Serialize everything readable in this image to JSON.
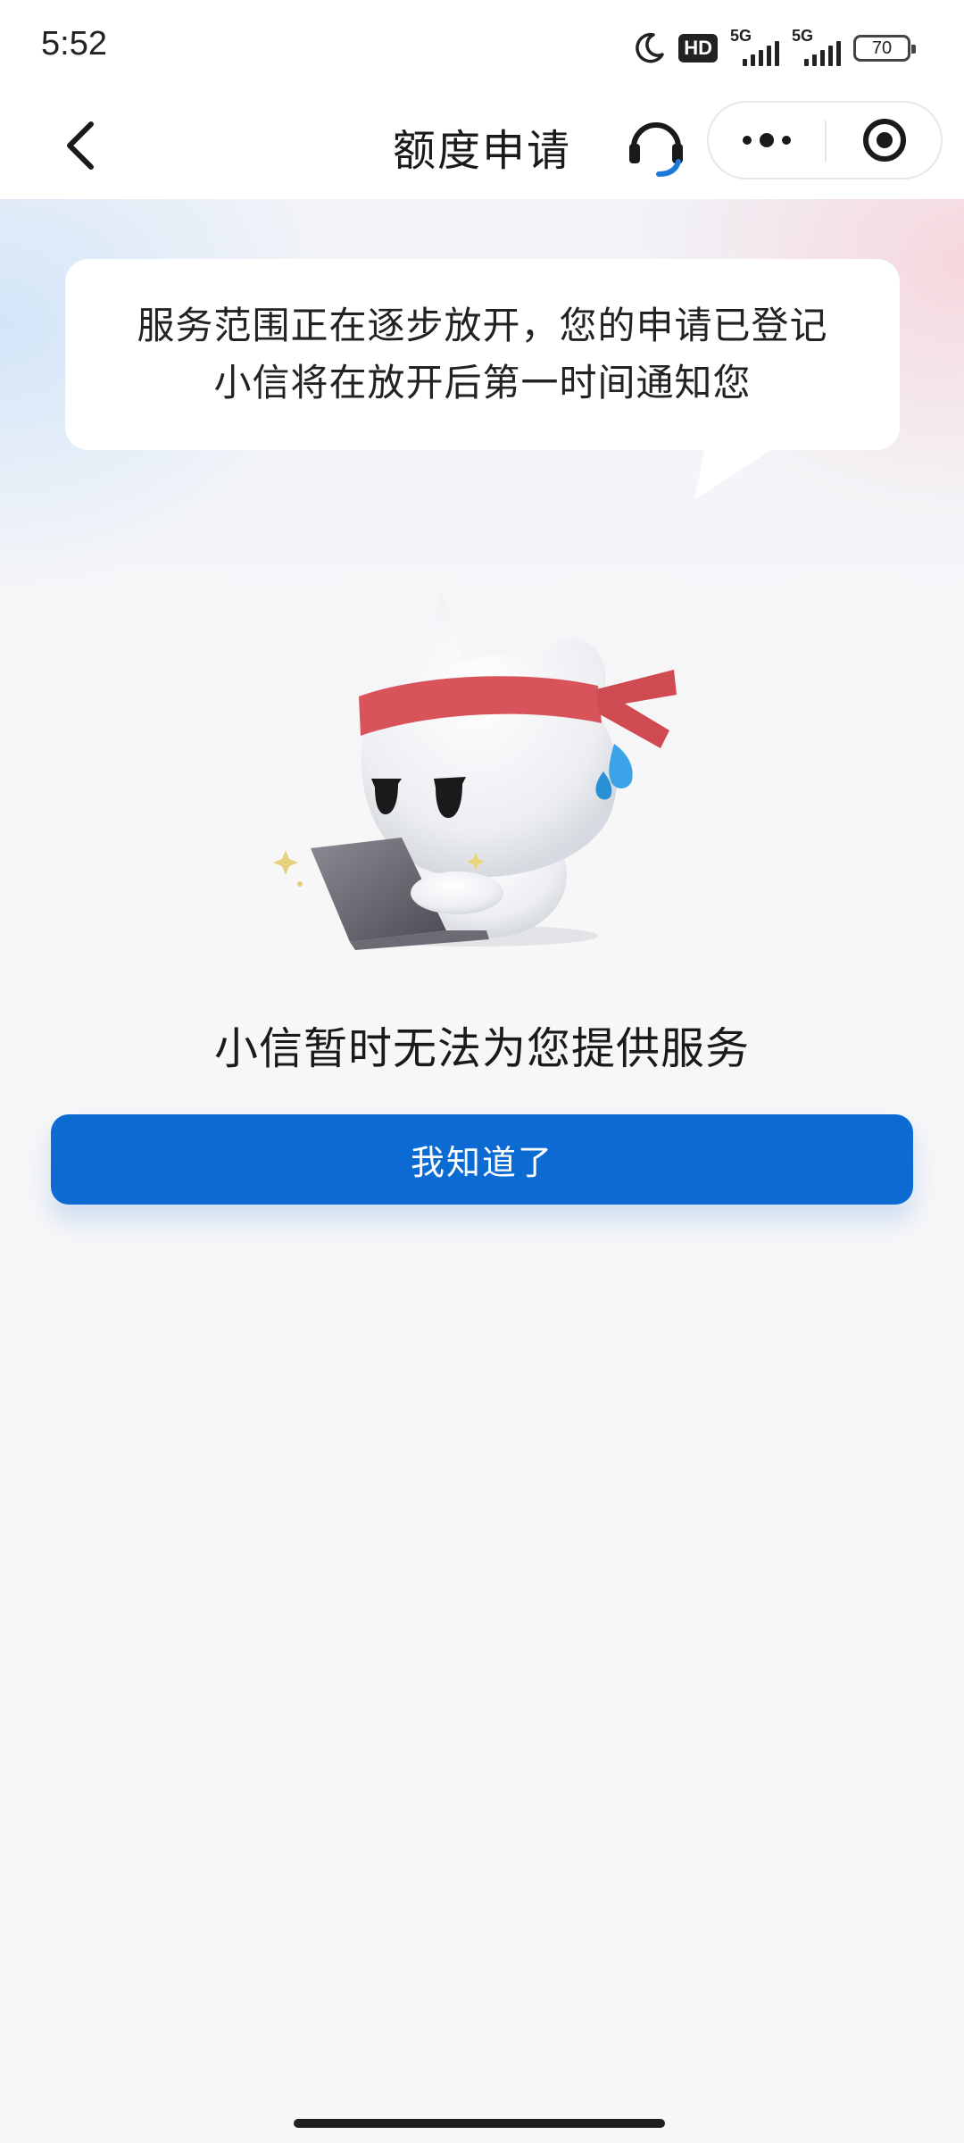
{
  "status_bar": {
    "time": "5:52",
    "hd_label": "HD",
    "network_1": "5G",
    "network_2": "5G",
    "battery": "70",
    "icons": [
      "moon-icon",
      "hd-icon",
      "signal-icon",
      "signal-icon",
      "battery-icon"
    ]
  },
  "nav": {
    "title": "额度申请",
    "back_icon": "chevron-left-icon",
    "service_icon": "headset-icon",
    "more_icon": "more-dots-icon",
    "close_icon": "target-circle-icon"
  },
  "bubble": {
    "line1": "服务范围正在逐步放开，您的申请已登记",
    "line2": "小信将在放开后第一时间通知您"
  },
  "main_message": "小信暂时无法为您提供服务",
  "confirm_button": "我知道了",
  "colors": {
    "accent": "#0b6bd3",
    "background": "#f7f7f8",
    "headband": "#d9545a"
  }
}
